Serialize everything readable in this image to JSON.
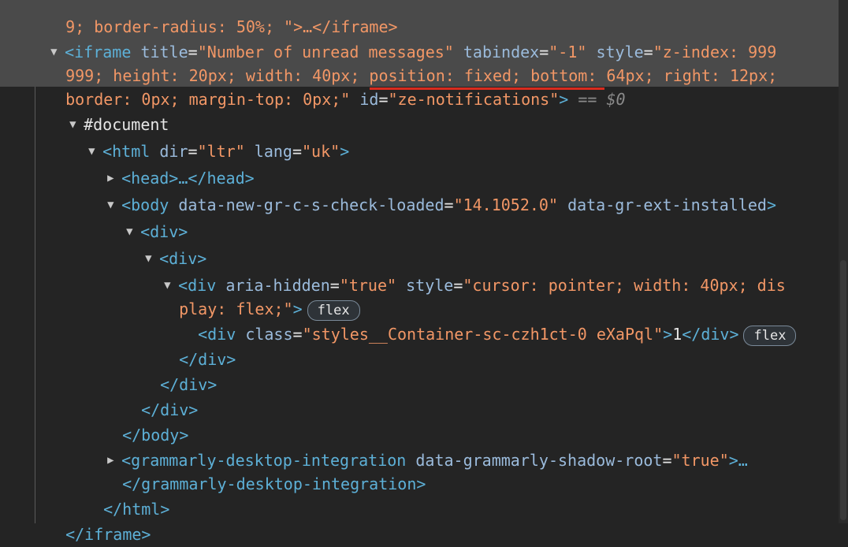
{
  "line0": {
    "text": "9; border-radius: 50%; \">…</iframe>"
  },
  "iframe": {
    "open": "<iframe",
    "attr_title": "title",
    "val_title": "\"Number of unread messages\"",
    "attr_tabindex": "tabindex",
    "val_tabindex": "\"-1\"",
    "attr_style": "style",
    "val_style_1": "\"z-index: 999",
    "val_style_2": "999; height: 20px; width: 40px; position: fixed; bottom: 64px; right: 12px;",
    "val_style_3": "border: 0px; margin-top: 0px;\"",
    "attr_id": "id",
    "val_id": "\"ze-notifications\"",
    "close": ">",
    "console_ref": "== $0",
    "end": "</iframe>"
  },
  "document": {
    "label": "#document"
  },
  "html": {
    "open_tag": "<html",
    "attr_dir": "dir",
    "val_dir": "\"ltr\"",
    "attr_lang": "lang",
    "val_lang": "\"uk\"",
    "close": ">",
    "end": "</html>"
  },
  "head": {
    "text": "<head>…</head>"
  },
  "body": {
    "open_tag": "<body",
    "attr_1": "data-new-gr-c-s-check-loaded",
    "val_1": "\"14.1052.0\"",
    "attr_2": "data-gr-ext-installed",
    "close": ">",
    "end": "</body>"
  },
  "div1": {
    "open": "<div>",
    "end": "</div>"
  },
  "div2": {
    "open": "<div>",
    "end": "</div>"
  },
  "div3": {
    "open_tag": "<div",
    "attr_aria": "aria-hidden",
    "val_aria": "\"true\"",
    "attr_style": "style",
    "val_style_1": "\"cursor: pointer; width: 40px; dis",
    "val_style_2": "play: flex;\"",
    "close": ">",
    "badge": "flex",
    "end": "</div>"
  },
  "div4": {
    "open_tag": "<div",
    "attr_class": "class",
    "val_class": "\"styles__Container-sc-czh1ct-0 eXaPql\"",
    "close": ">",
    "content": "1",
    "end": "</div>",
    "badge": "flex"
  },
  "grammarly": {
    "open_tag": "<grammarly-desktop-integration",
    "attr": "data-grammarly-shadow-root",
    "val": "\"true\"",
    "close": ">…",
    "end": "</grammarly-desktop-integration>"
  }
}
